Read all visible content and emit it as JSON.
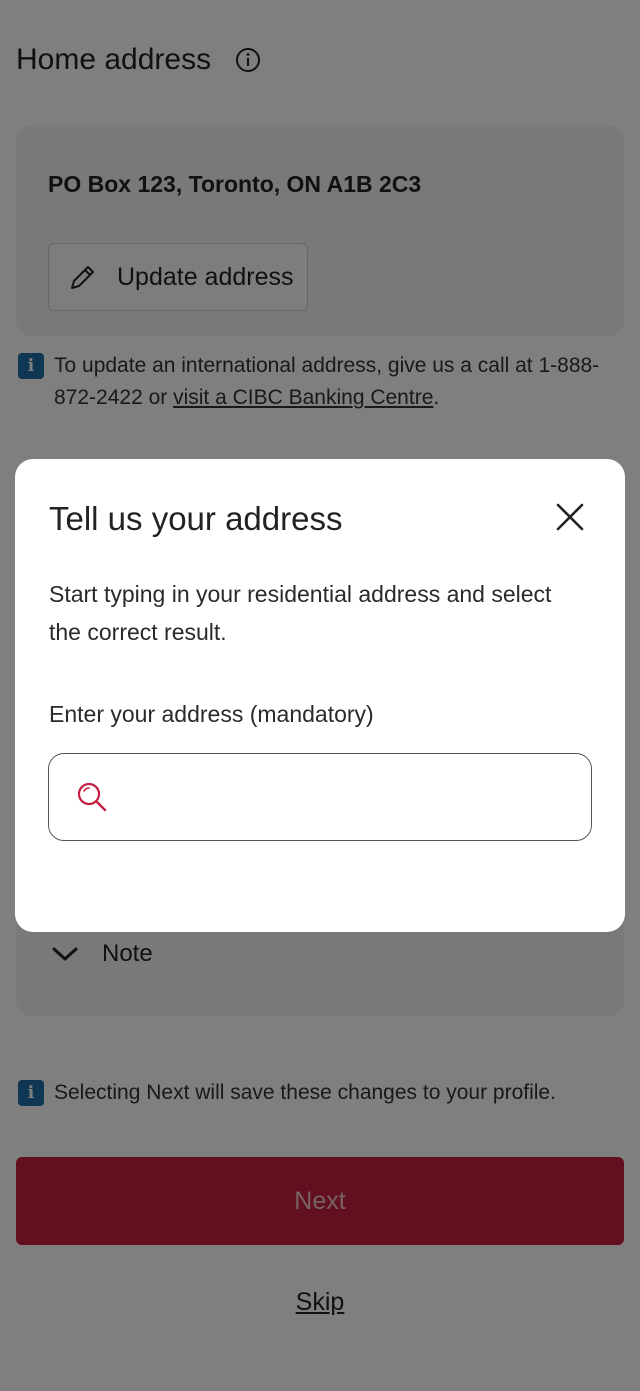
{
  "page": {
    "title": "Home address",
    "address": "PO Box 123, Toronto, ON A1B 2C3",
    "update_button_label": "Update address",
    "international_note_prefix": "To update an international address, give us a call at 1-888-872-2422 or ",
    "international_note_link": "visit a CIBC Banking Centre",
    "international_note_suffix": ".",
    "note_toggle_label": "Note",
    "save_note": "Selecting Next will save these changes to your profile.",
    "next_button_label": "Next",
    "skip_link_label": "Skip"
  },
  "dialog": {
    "title": "Tell us your address",
    "description": "Start typing in your residential address and select the correct result.",
    "field_label": "Enter your address (mandatory)",
    "field_value": "",
    "field_placeholder": ""
  },
  "colors": {
    "brand_red": "#c41f3e",
    "info_blue": "#1e6fa8",
    "search_icon": "#c41f3e"
  },
  "icons": {
    "title_info": "info-circle-icon",
    "update": "pencil-icon",
    "note_info": "info-badge-icon",
    "note_toggle": "chevron-down-icon",
    "close": "close-icon",
    "search": "search-icon"
  }
}
